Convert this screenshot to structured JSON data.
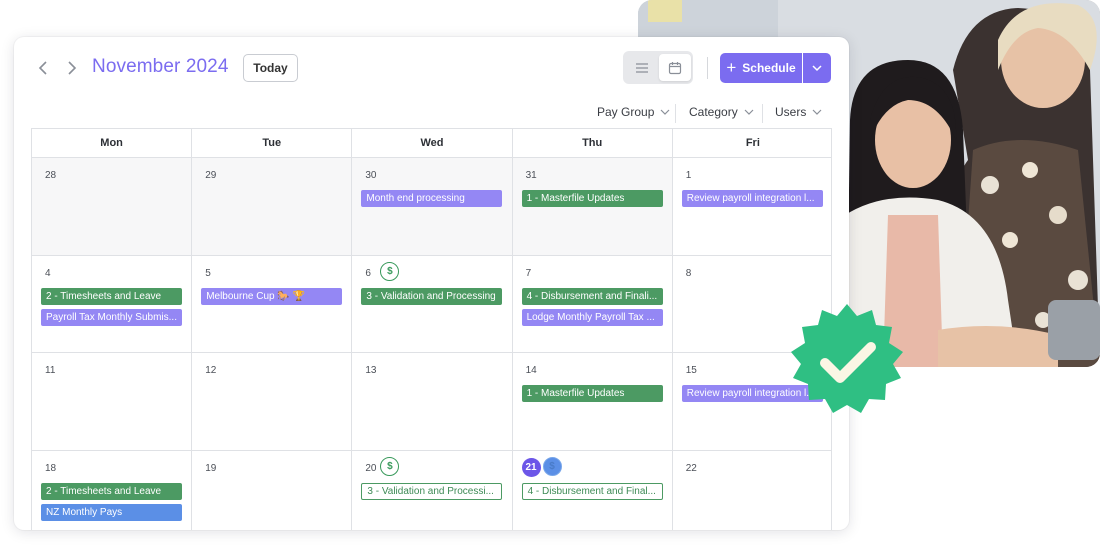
{
  "calendar": {
    "title": "November 2024",
    "today_label": "Today",
    "schedule_label": "Schedule",
    "filters": [
      "Pay Group",
      "Category",
      "Users"
    ],
    "weekdays": [
      "Mon",
      "Tue",
      "Wed",
      "Thu",
      "Fri"
    ],
    "weeks": [
      [
        {
          "num": "28",
          "muted": true,
          "events": []
        },
        {
          "num": "29",
          "muted": true,
          "events": []
        },
        {
          "num": "30",
          "muted": true,
          "events": [
            {
              "label": "Month end processing",
              "color": "purple"
            }
          ]
        },
        {
          "num": "31",
          "muted": true,
          "events": [
            {
              "label": "1 - Masterfile Updates",
              "color": "green"
            }
          ]
        },
        {
          "num": "1",
          "events": [
            {
              "label": "Review payroll integration l...",
              "color": "purple"
            }
          ]
        }
      ],
      [
        {
          "num": "4",
          "events": [
            {
              "label": "2 - Timesheets and Leave",
              "color": "green"
            },
            {
              "label": "Payroll Tax Monthly Submis...",
              "color": "purple"
            }
          ]
        },
        {
          "num": "5",
          "events": [
            {
              "label": "Melbourne Cup 🐎 🏆",
              "color": "purple"
            }
          ]
        },
        {
          "num": "6",
          "coin": "$",
          "events": [
            {
              "label": "3 - Validation and Processing",
              "color": "green"
            }
          ]
        },
        {
          "num": "7",
          "events": [
            {
              "label": "4 - Disbursement and Finali...",
              "color": "green"
            },
            {
              "label": "Lodge Monthly Payroll Tax ...",
              "color": "purple"
            }
          ]
        },
        {
          "num": "8",
          "events": []
        }
      ],
      [
        {
          "num": "11",
          "events": []
        },
        {
          "num": "12",
          "events": []
        },
        {
          "num": "13",
          "events": []
        },
        {
          "num": "14",
          "events": [
            {
              "label": "1 - Masterfile Updates",
              "color": "green"
            }
          ]
        },
        {
          "num": "15",
          "events": [
            {
              "label": "Review payroll integration l...",
              "color": "purple"
            }
          ]
        }
      ],
      [
        {
          "num": "18",
          "events": [
            {
              "label": "2 - Timesheets and Leave",
              "color": "green"
            },
            {
              "label": "NZ Monthly Pays",
              "color": "blue"
            }
          ]
        },
        {
          "num": "19",
          "events": []
        },
        {
          "num": "20",
          "coin": "$",
          "events": [
            {
              "label": "3 - Validation and Processi...",
              "color": "green-outline"
            }
          ]
        },
        {
          "num": "21",
          "today": true,
          "coin": "$",
          "coin_color": "blue",
          "events": [
            {
              "label": "4 - Disbursement and Final...",
              "color": "green-outline"
            }
          ]
        },
        {
          "num": "22",
          "events": []
        }
      ]
    ]
  },
  "colors": {
    "accent": "#7b6cf0",
    "event_purple": "#9487f4",
    "event_green": "#4c9a63",
    "event_blue": "#5b8fe6",
    "badge_green": "#2fbf83"
  },
  "icons": [
    "chevron-left-icon",
    "chevron-right-icon",
    "list-view-icon",
    "calendar-view-icon",
    "plus-icon",
    "chevron-down-icon",
    "dollar-icon",
    "verified-check-icon"
  ]
}
